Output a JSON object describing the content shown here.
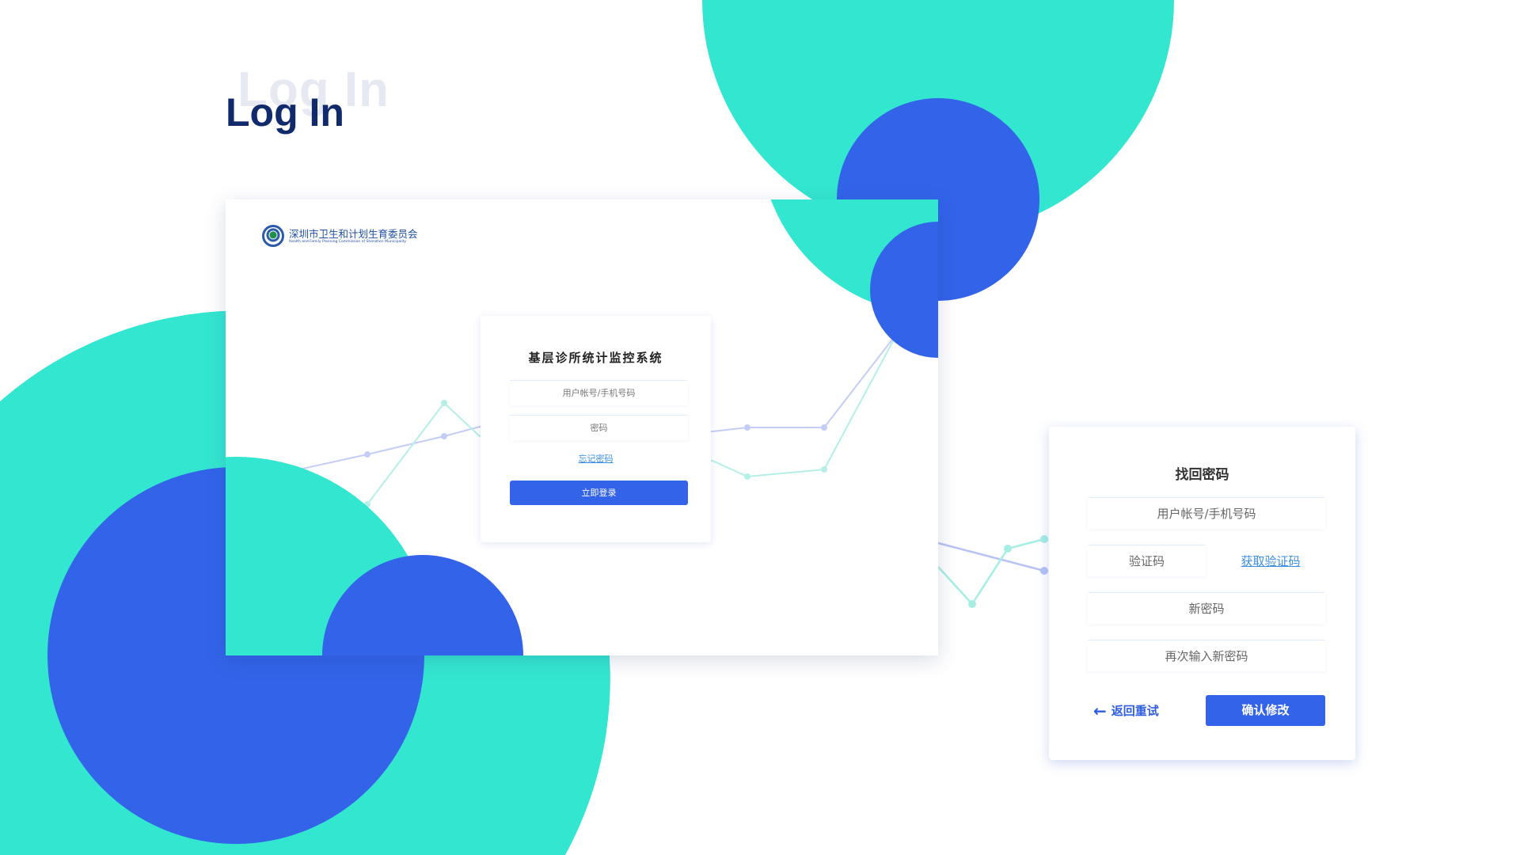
{
  "heading": {
    "title": "Log In",
    "ghost_title": "Log In"
  },
  "colors": {
    "teal": "#33e6d0",
    "blue": "#3263e9",
    "navy": "#102a6b"
  },
  "org": {
    "name_cn": "深圳市卫生和计划生育委员会",
    "name_en": "Health and Family Planning Commission of Shenzhen Municipality"
  },
  "login": {
    "title": "基层诊所统计监控系统",
    "username_placeholder": "用户帐号/手机号码",
    "password_placeholder": "密码",
    "forgot_link": "忘记密码",
    "submit": "立即登录"
  },
  "reset": {
    "title": "找回密码",
    "username_placeholder": "用户帐号/手机号码",
    "code_placeholder": "验证码",
    "get_code_link": "获取验证码",
    "new_password_placeholder": "新密码",
    "confirm_password_placeholder": "再次输入新密码",
    "back": "返回重试",
    "confirm": "确认修改"
  }
}
